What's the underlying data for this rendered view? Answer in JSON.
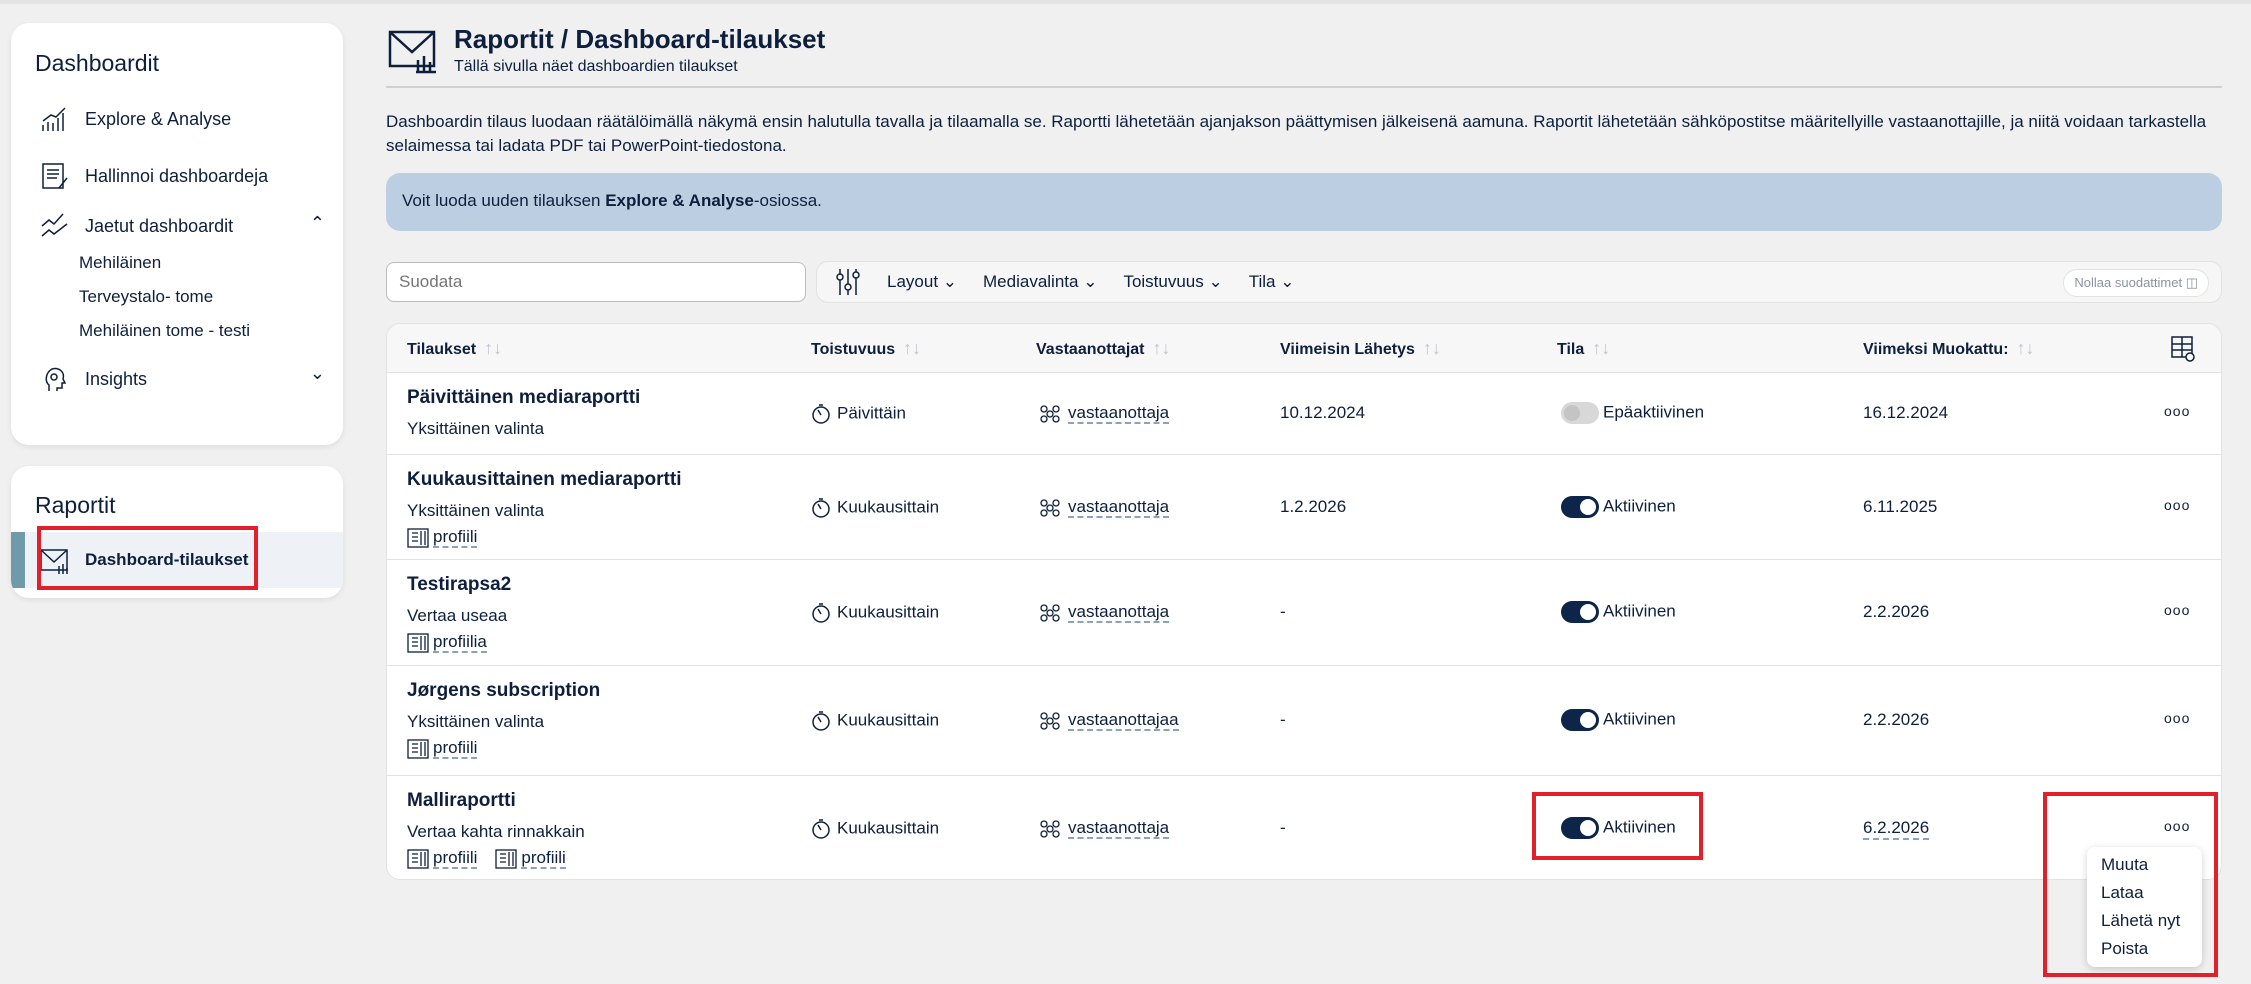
{
  "sidebar": {
    "dashboards_title": "Dashboardit",
    "items": [
      {
        "label": "Explore & Analyse"
      },
      {
        "label": "Hallinnoi dashboardeja"
      },
      {
        "label": "Jaetut dashboardit"
      },
      {
        "label": "Insights"
      }
    ],
    "shared": [
      "Mehiläinen",
      "Terveystalo- tome",
      "Mehiläinen tome - testi"
    ],
    "reports_title": "Raportit",
    "reports_item": "Dashboard-tilaukset"
  },
  "header": {
    "title": "Raportit / Dashboard-tilaukset",
    "subtitle": "Tällä sivulla näet dashboardien tilaukset"
  },
  "description": "Dashboardin tilaus luodaan räätälöimällä näkymä ensin halutulla tavalla ja tilaamalla se. Raportti lähetetään ajanjakson päättymisen jälkeisenä aamuna. Raportit lähetetään sähköpostitse määritellyille vastaanottajille, ja niitä voidaan tarkastella selaimessa tai ladata PDF tai PowerPoint-tiedostona.",
  "info": {
    "prefix": "Voit luoda uuden tilauksen ",
    "bold": "Explore & Analyse",
    "suffix": "-osiossa."
  },
  "search": {
    "placeholder": "Suodata"
  },
  "filters": {
    "items": [
      "Layout",
      "Mediavalinta",
      "Toistuvuus",
      "Tila"
    ],
    "reset": "Nollaa suodattimet"
  },
  "table": {
    "columns": [
      "Tilaukset",
      "Toistuvuus",
      "Vastaanottajat",
      "Viimeisin Lähetys",
      "Tila",
      "Viimeksi Muokattu:"
    ],
    "rows": [
      {
        "title": "Päivittäinen mediaraportti",
        "subtitle": "Yksittäinen valinta",
        "profiles": [],
        "frequency": "Päivittäin",
        "recipients": "vastaanottaja",
        "last_sent": "10.12.2024",
        "status": "Epäaktiivinen",
        "active": false,
        "modified": "16.12.2024"
      },
      {
        "title": "Kuukausittainen mediaraportti",
        "subtitle": "Yksittäinen valinta",
        "profiles": [
          "profiili"
        ],
        "frequency": "Kuukausittain",
        "recipients": "vastaanottaja",
        "last_sent": "1.2.2026",
        "status": "Aktiivinen",
        "active": true,
        "modified": "6.11.2025"
      },
      {
        "title": "Testirapsa2",
        "subtitle": "Vertaa useaa",
        "profiles": [
          "profiilia"
        ],
        "frequency": "Kuukausittain",
        "recipients": "vastaanottaja",
        "last_sent": "-",
        "status": "Aktiivinen",
        "active": true,
        "modified": "2.2.2026"
      },
      {
        "title": "Jørgens subscription",
        "subtitle": "Yksittäinen valinta",
        "profiles": [
          "profiili"
        ],
        "frequency": "Kuukausittain",
        "recipients": "vastaanottajaa",
        "last_sent": "-",
        "status": "Aktiivinen",
        "active": true,
        "modified": "2.2.2026"
      },
      {
        "title": "Malliraportti",
        "subtitle": "Vertaa kahta rinnakkain",
        "profiles": [
          "profiili",
          "profiili"
        ],
        "frequency": "Kuukausittain",
        "recipients": "vastaanottaja",
        "last_sent": "-",
        "status": "Aktiivinen",
        "active": true,
        "modified": "6.2.2026"
      }
    ],
    "more": "ooo"
  },
  "menu": [
    "Muuta",
    "Lataa",
    "Lähetä nyt",
    "Poista"
  ],
  "colors": {
    "primary": "#0d1f3c",
    "info": "#bccfe2",
    "highlight": "#e0202a"
  }
}
